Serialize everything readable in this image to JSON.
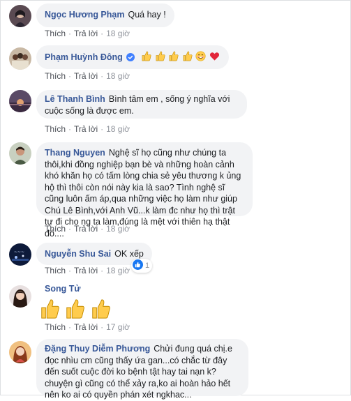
{
  "actions": {
    "like": "Thích",
    "reply": "Trả lời",
    "separator": "·"
  },
  "colors": {
    "name": "#385898",
    "bubble": "#f2f3f5",
    "meta": "#90949c",
    "like_blue": "#1877f2"
  },
  "comments": [
    {
      "name": "Ngọc Hương Phạm",
      "text": "Quá hay !",
      "time": "18 giờ",
      "avatar_icon": "avatar-woman-icon"
    },
    {
      "name": "Phạm Huỳnh Đông",
      "text": "",
      "emoji": [
        "thumbs-up-icon",
        "thumbs-up-icon",
        "thumbs-up-icon",
        "thumbs-up-icon",
        "smile-icon",
        "red-heart-icon"
      ],
      "verified": true,
      "time": "18 giờ",
      "avatar_icon": "avatar-group-icon"
    },
    {
      "name": "Lê Thanh Bình",
      "text": "Bình tâm em , sống ý nghĩa với cuộc sống là được em.",
      "time": "18 giờ",
      "avatar_icon": "avatar-sunset-icon"
    },
    {
      "name": "Thang Nguyen",
      "text": "Nghệ sĩ họ cũng như chúng ta thôi,khi đồng nghiệp bạn bè và những hoàn cảnh khó khăn họ có tấm lòng chia sẻ yêu thương k ủng hộ thì thôi còn nói này kia là sao? Tình nghệ sĩ cũng luôn ấm áp,qua những việc họ làm như giúp Chú Lê Bình,với Anh Vũ...k làm đc như họ thì trật tự đi cho ng ta làm,đúng là mệt với thiên hạ thật đó....",
      "time": "18 giờ",
      "avatar_icon": "avatar-man-icon"
    },
    {
      "name": "Nguyễn Shu Sai",
      "text": "OK xếp",
      "time": "18 giờ",
      "reaction_count": "1",
      "avatar_icon": "avatar-night-icon"
    },
    {
      "name": "Song Tử",
      "text": "",
      "big_emoji": [
        "thumbs-up-icon",
        "thumbs-up-icon",
        "thumbs-up-icon"
      ],
      "time": "17 giờ",
      "avatar_icon": "avatar-girl-icon"
    },
    {
      "name": "Đặng Thuy Diễm Phương",
      "text": "Chửi đung quá chị.e đọc nhìu cm cũng thấy ứa gan...có chắc từ đây đến suốt cuộc đời ko bệnh tật hay tai nạn k?chuyện gì cũng có thể xảy ra,ko ai hoàn hảo hết nên ko ai có quyền phán xét ngkhac...",
      "time": "",
      "avatar_icon": "avatar-woman-icon"
    }
  ]
}
